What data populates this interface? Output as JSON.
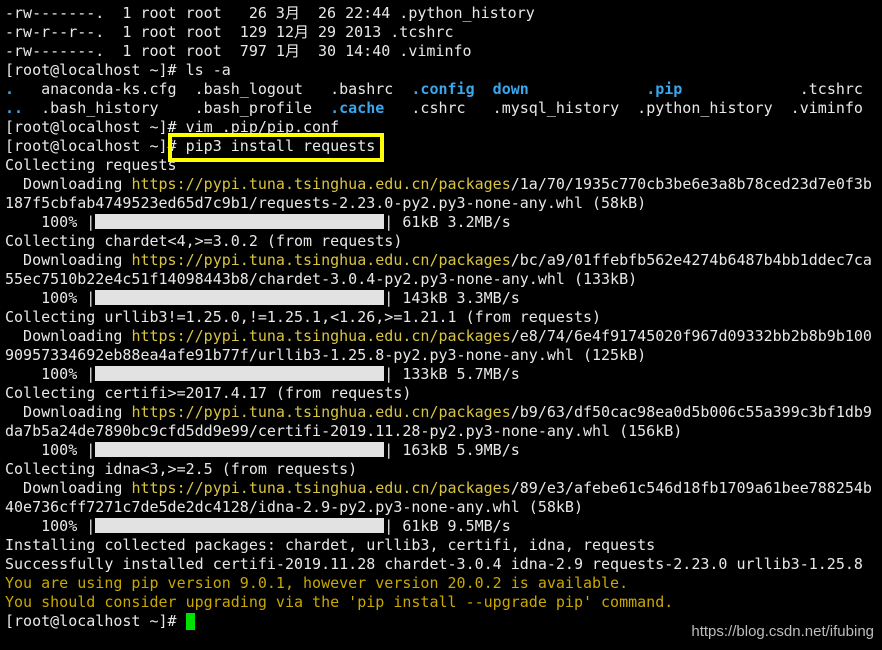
{
  "colors": {
    "background": "#000000",
    "text": "#e8e8e8",
    "directory": "#3aa6ec",
    "url": "#d8c440",
    "warning": "#c9a800",
    "cursor": "#00e000",
    "highlight_box": "#ffff00"
  },
  "terminal": {
    "lines": [
      [
        {
          "t": "-rw-------.  1 root root   26 3月  26 22:44 .python_history"
        }
      ],
      [
        {
          "t": "-rw-r--r--.  1 root root  129 12月 29 2013 .tcshrc"
        }
      ],
      [
        {
          "t": "-rw-------.  1 root root  797 1月  30 14:40 .viminfo"
        }
      ],
      [
        {
          "t": "[root@localhost ~]# ls -a"
        }
      ],
      [
        {
          "t": ".",
          "c": "dir"
        },
        {
          "t": "   anaconda-ks.cfg  .bash_logout   .bashrc  "
        },
        {
          "t": ".config",
          "c": "dir"
        },
        {
          "t": "  "
        },
        {
          "t": "down",
          "c": "dir"
        },
        {
          "t": "             "
        },
        {
          "t": ".pip",
          "c": "dir"
        },
        {
          "t": "             .tcshrc"
        }
      ],
      [
        {
          "t": "..",
          "c": "dir"
        },
        {
          "t": "  .bash_history    .bash_profile  "
        },
        {
          "t": ".cache",
          "c": "dir"
        },
        {
          "t": "   .cshrc   .mysql_history  .python_history  .viminfo"
        }
      ],
      [
        {
          "t": "[root@localhost ~]# vim .pip/pip.conf"
        }
      ],
      [
        {
          "t": "[root@localhost ~]# pip3 install requests"
        }
      ],
      [
        {
          "t": "Collecting requests"
        }
      ],
      [
        {
          "t": "  Downloading "
        },
        {
          "t": "https://pypi.tuna.tsinghua.edu.cn/packages",
          "c": "url"
        },
        {
          "t": "/1a/70/1935c770cb3be6e3a8b78ced23d7e0f3b"
        }
      ],
      [
        {
          "t": "187f5cbfab4749523ed65d7c9b1/requests-2.23.0-py2.py3-none-any.whl (58kB)"
        }
      ],
      [
        {
          "t": "    100% |"
        },
        {
          "bar": 100
        },
        {
          "t": "| 61kB 3.2MB/s"
        }
      ],
      [
        {
          "t": "Collecting chardet<4,>=3.0.2 (from requests)"
        }
      ],
      [
        {
          "t": "  Downloading "
        },
        {
          "t": "https://pypi.tuna.tsinghua.edu.cn/packages",
          "c": "url"
        },
        {
          "t": "/bc/a9/01ffebfb562e4274b6487b4bb1ddec7ca"
        }
      ],
      [
        {
          "t": "55ec7510b22e4c51f14098443b8/chardet-3.0.4-py2.py3-none-any.whl (133kB)"
        }
      ],
      [
        {
          "t": "    100% |"
        },
        {
          "bar": 100
        },
        {
          "t": "| 143kB 3.3MB/s"
        }
      ],
      [
        {
          "t": "Collecting urllib3!=1.25.0,!=1.25.1,<1.26,>=1.21.1 (from requests)"
        }
      ],
      [
        {
          "t": "  Downloading "
        },
        {
          "t": "https://pypi.tuna.tsinghua.edu.cn/packages",
          "c": "url"
        },
        {
          "t": "/e8/74/6e4f91745020f967d09332bb2b8b9b100"
        }
      ],
      [
        {
          "t": "90957334692eb88ea4afe91b77f/urllib3-1.25.8-py2.py3-none-any.whl (125kB)"
        }
      ],
      [
        {
          "t": "    100% |"
        },
        {
          "bar": 100
        },
        {
          "t": "| 133kB 5.7MB/s"
        }
      ],
      [
        {
          "t": "Collecting certifi>=2017.4.17 (from requests)"
        }
      ],
      [
        {
          "t": "  Downloading "
        },
        {
          "t": "https://pypi.tuna.tsinghua.edu.cn/packages",
          "c": "url"
        },
        {
          "t": "/b9/63/df50cac98ea0d5b006c55a399c3bf1db9"
        }
      ],
      [
        {
          "t": "da7b5a24de7890bc9cfd5dd9e99/certifi-2019.11.28-py2.py3-none-any.whl (156kB)"
        }
      ],
      [
        {
          "t": "    100% |"
        },
        {
          "bar": 100
        },
        {
          "t": "| 163kB 5.9MB/s"
        }
      ],
      [
        {
          "t": "Collecting idna<3,>=2.5 (from requests)"
        }
      ],
      [
        {
          "t": "  Downloading "
        },
        {
          "t": "https://pypi.tuna.tsinghua.edu.cn/packages",
          "c": "url"
        },
        {
          "t": "/89/e3/afebe61c546d18fb1709a61bee788254b"
        }
      ],
      [
        {
          "t": "40e736cff7271c7de5de2dc4128/idna-2.9-py2.py3-none-any.whl (58kB)"
        }
      ],
      [
        {
          "t": "    100% |"
        },
        {
          "bar": 100
        },
        {
          "t": "| 61kB 9.5MB/s"
        }
      ],
      [
        {
          "t": "Installing collected packages: chardet, urllib3, certifi, idna, requests"
        }
      ],
      [
        {
          "t": "Successfully installed certifi-2019.11.28 chardet-3.0.4 idna-2.9 requests-2.23.0 urllib3-1.25.8"
        }
      ],
      [
        {
          "t": "You are using pip version 9.0.1, however version 20.0.2 is available.",
          "c": "warn"
        }
      ],
      [
        {
          "t": "You should consider upgrading via the 'pip install --upgrade pip' command.",
          "c": "warn"
        }
      ],
      [
        {
          "t": "[root@localhost ~]# "
        },
        {
          "cursor": true
        }
      ]
    ]
  },
  "watermark": "https://blog.csdn.net/ifubing"
}
